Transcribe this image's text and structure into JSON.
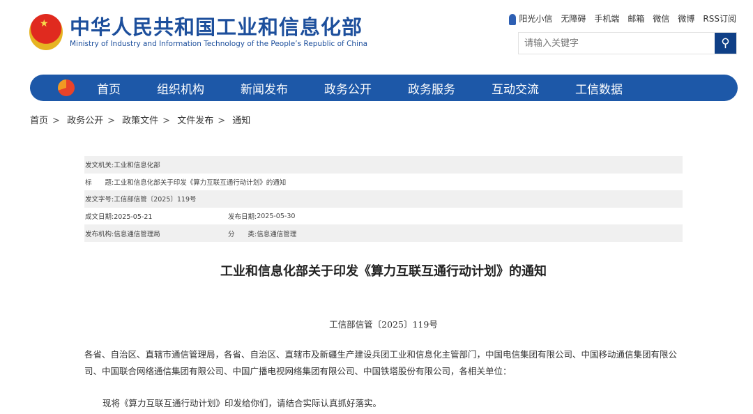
{
  "header": {
    "title_cn": "中华人民共和国工业和信息化部",
    "title_en": "Ministry of Industry and Information Technology of the People’s Republic of China",
    "links": [
      "阳光小信",
      "无障碍",
      "手机端",
      "邮箱",
      "微信",
      "微博",
      "RSS订阅"
    ],
    "search_placeholder": "请输入关键字"
  },
  "nav": [
    "首页",
    "组织机构",
    "新闻发布",
    "政务公开",
    "政务服务",
    "互动交流",
    "工信数据"
  ],
  "breadcrumb": [
    "首页",
    "政务公开",
    "政策文件",
    "文件发布",
    "通知"
  ],
  "info": {
    "issuer_label": "发文机关:",
    "issuer": "工业和信息化部",
    "title_label": "标　　题:",
    "title": "工业和信息化部关于印发《算力互联互通行动计划》的通知",
    "docno_label": "发文字号:",
    "docno": "工信部信管〔2025〕119号",
    "written_label": "成文日期:",
    "written": "2025-05-21",
    "published_label": "发布日期:",
    "published": "2025-05-30",
    "org_label": "发布机构:",
    "org": "信息通信管理局",
    "category_label": "分　　类:",
    "category": "信息通信管理"
  },
  "article": {
    "title": "工业和信息化部关于印发《算力互联互通行动计划》的通知",
    "docno": "工信部信管〔2025〕119号",
    "p1": "各省、自治区、直辖市通信管理局，各省、自治区、直辖市及新疆生产建设兵团工业和信息化主管部门，中国电信集团有限公司、中国移动通信集团有限公司、中国联合网络通信集团有限公司、中国广播电视网络集团有限公司、中国铁塔股份有限公司，各相关单位：",
    "p2": "现将《算力互联互通行动计划》印发给你们，请结合实际认真抓好落实。"
  }
}
